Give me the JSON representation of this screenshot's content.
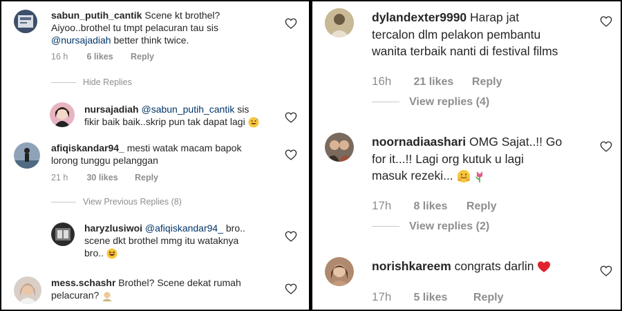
{
  "left": {
    "c1": {
      "user": "sabun_putih_cantik",
      "text1": "Scene kt brothel?",
      "text2": "Aiyoo..brothel tu tmpt pelacuran tau sis",
      "mention": "@nursajadiah",
      "text3": "better think twice.",
      "time": "16 h",
      "likes": "6 likes",
      "reply": "Reply"
    },
    "hide_replies": "Hide Replies",
    "c2": {
      "user": "nursajadiah",
      "mention": "@sabun_putih_cantik",
      "text1": "sis",
      "text2": "fikir baik baik..skrip pun tak dapat lagi",
      "emoji": "grinning-sweat-emoji"
    },
    "c3": {
      "user": "afiqiskandar94_",
      "text1": "mesti watak macam bapok",
      "text2": "lorong tunggu pelanggan",
      "time": "21 h",
      "likes": "30 likes",
      "reply": "Reply"
    },
    "view_previous": "View Previous Replies (8)",
    "c4": {
      "user": "haryzlusiwoi",
      "mention": "@afiqiskandar94_",
      "text1": "bro..",
      "text2": "scene dkt brothel mmg itu wataknya",
      "text3": "bro..",
      "emoji": "laughing-emoji"
    },
    "c5": {
      "user": "mess.schashr",
      "text1": "Brothel? Scene dekat rumah",
      "text2": "pelacuran?",
      "emoji": "shrug-emoji"
    }
  },
  "right": {
    "c1": {
      "user": "dylandexter9990",
      "text1": "Harap jat",
      "text2": "tercalon dlm pelakon pembantu",
      "text3": "wanita terbaik nanti di festival films",
      "time": "16h",
      "likes": "21 likes",
      "reply": "Reply",
      "view_replies": "View replies (4)"
    },
    "c2": {
      "user": "noornadiaashari",
      "text1": "OMG Sajat..!! Go",
      "text2": "for it...!! Lagi org kutuk u lagi",
      "text3": "masuk rezeki...",
      "time": "17h",
      "likes": "8 likes",
      "reply": "Reply",
      "view_replies": "View replies (2)",
      "emoji": "hugging-emoji",
      "emoji2": "tulip-emoji"
    },
    "c3": {
      "user": "norishkareem",
      "text1": "congrats darlin",
      "time": "17h",
      "likes": "5 likes",
      "reply": "Reply",
      "emoji": "red-heart-emoji"
    }
  },
  "colors": {
    "username": "#262626",
    "muted": "#8e8e8e",
    "mention": "#003569",
    "divider": "#c7c7c7",
    "background": "#ffffff"
  }
}
